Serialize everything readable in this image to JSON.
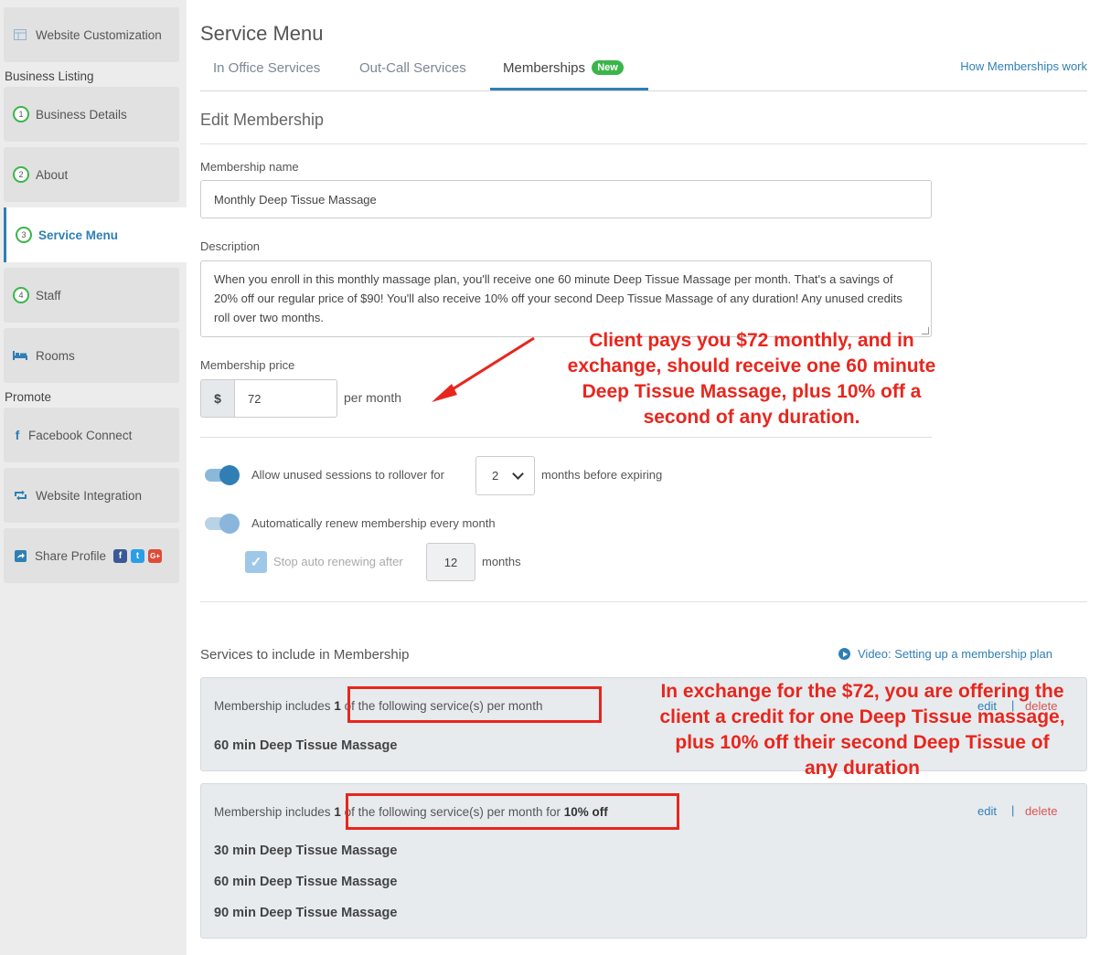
{
  "sidebar": {
    "website_customization": "Website Customization",
    "business_listing_header": "Business Listing",
    "business_details": {
      "num": "1",
      "label": "Business Details"
    },
    "about": {
      "num": "2",
      "label": "About"
    },
    "service_menu": {
      "num": "3",
      "label": "Service Menu"
    },
    "staff": {
      "num": "4",
      "label": "Staff"
    },
    "rooms": "Rooms",
    "promote_header": "Promote",
    "facebook_connect": "Facebook Connect",
    "website_integration": "Website Integration",
    "share_profile": "Share Profile",
    "social": {
      "facebook": "f",
      "twitter": "t",
      "google": "G+"
    }
  },
  "header": {
    "title": "Service Menu",
    "tabs": [
      {
        "label": "In Office Services"
      },
      {
        "label": "Out-Call Services"
      },
      {
        "label": "Memberships",
        "badge": "New"
      }
    ],
    "how_link": "How Memberships work"
  },
  "form": {
    "section_title": "Edit Membership",
    "name_label": "Membership name",
    "name_value": "Monthly Deep Tissue Massage",
    "description_label": "Description",
    "description_value": "When you enroll in this monthly massage plan, you'll receive one 60 minute Deep Tissue Massage per month. That's a savings of 20% off our regular price of $90! You'll also receive 10% off your second Deep Tissue Massage of any duration! Any unused credits roll over two months.",
    "price_label": "Membership price",
    "currency": "$",
    "price_value": "72",
    "per_month": "per month",
    "rollover_text": "Allow unused sessions to rollover for",
    "rollover_value": "2",
    "rollover_suffix": "months before expiring",
    "renew_text": "Automatically renew membership every month",
    "stop_text": "Stop auto renewing after",
    "stop_value": "12",
    "stop_suffix": "months"
  },
  "services": {
    "title": "Services to include in Membership",
    "video_link": "Video: Setting up a membership plan",
    "edit": "edit",
    "separator": "|",
    "delete": "delete",
    "box1": {
      "prefix": "Membership includes",
      "count": "1",
      "suffix": "of the following service(s) per month",
      "items": [
        "60 min Deep Tissue Massage"
      ]
    },
    "box2": {
      "prefix": "Membership includes",
      "count": "1",
      "suffix": "of the following service(s) per month for",
      "discount": "10% off",
      "items": [
        "30 min Deep Tissue Massage",
        "60 min Deep Tissue Massage",
        "90 min Deep Tissue Massage"
      ]
    }
  },
  "annotations": {
    "price_note": "Client pays you $72 monthly, and in exchange, should receive one 60 minute Deep Tissue Massage, plus 10% off a second of any duration.",
    "services_note": "In exchange for the $72, you are offering the client a credit for one Deep Tissue massage, plus 10% off their second Deep Tissue of any duration",
    "color": "#e8261d"
  },
  "colors": {
    "accent": "#2f7fb5",
    "success": "#3bb54a",
    "danger": "#d9534f"
  }
}
